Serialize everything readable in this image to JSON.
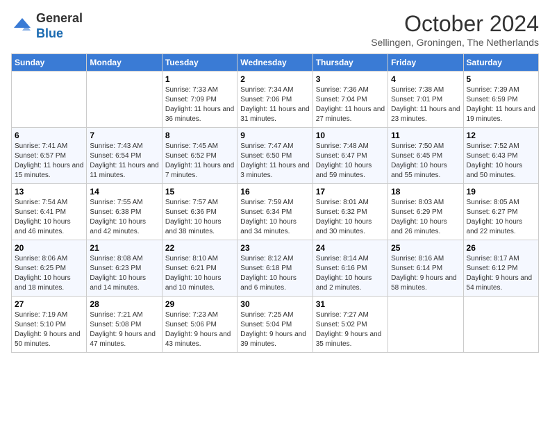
{
  "header": {
    "logo_line1": "General",
    "logo_line2": "Blue",
    "month_title": "October 2024",
    "subtitle": "Sellingen, Groningen, The Netherlands"
  },
  "weekdays": [
    "Sunday",
    "Monday",
    "Tuesday",
    "Wednesday",
    "Thursday",
    "Friday",
    "Saturday"
  ],
  "weeks": [
    [
      {
        "day": "",
        "info": ""
      },
      {
        "day": "",
        "info": ""
      },
      {
        "day": "1",
        "info": "Sunrise: 7:33 AM\nSunset: 7:09 PM\nDaylight: 11 hours and 36 minutes."
      },
      {
        "day": "2",
        "info": "Sunrise: 7:34 AM\nSunset: 7:06 PM\nDaylight: 11 hours and 31 minutes."
      },
      {
        "day": "3",
        "info": "Sunrise: 7:36 AM\nSunset: 7:04 PM\nDaylight: 11 hours and 27 minutes."
      },
      {
        "day": "4",
        "info": "Sunrise: 7:38 AM\nSunset: 7:01 PM\nDaylight: 11 hours and 23 minutes."
      },
      {
        "day": "5",
        "info": "Sunrise: 7:39 AM\nSunset: 6:59 PM\nDaylight: 11 hours and 19 minutes."
      }
    ],
    [
      {
        "day": "6",
        "info": "Sunrise: 7:41 AM\nSunset: 6:57 PM\nDaylight: 11 hours and 15 minutes."
      },
      {
        "day": "7",
        "info": "Sunrise: 7:43 AM\nSunset: 6:54 PM\nDaylight: 11 hours and 11 minutes."
      },
      {
        "day": "8",
        "info": "Sunrise: 7:45 AM\nSunset: 6:52 PM\nDaylight: 11 hours and 7 minutes."
      },
      {
        "day": "9",
        "info": "Sunrise: 7:47 AM\nSunset: 6:50 PM\nDaylight: 11 hours and 3 minutes."
      },
      {
        "day": "10",
        "info": "Sunrise: 7:48 AM\nSunset: 6:47 PM\nDaylight: 10 hours and 59 minutes."
      },
      {
        "day": "11",
        "info": "Sunrise: 7:50 AM\nSunset: 6:45 PM\nDaylight: 10 hours and 55 minutes."
      },
      {
        "day": "12",
        "info": "Sunrise: 7:52 AM\nSunset: 6:43 PM\nDaylight: 10 hours and 50 minutes."
      }
    ],
    [
      {
        "day": "13",
        "info": "Sunrise: 7:54 AM\nSunset: 6:41 PM\nDaylight: 10 hours and 46 minutes."
      },
      {
        "day": "14",
        "info": "Sunrise: 7:55 AM\nSunset: 6:38 PM\nDaylight: 10 hours and 42 minutes."
      },
      {
        "day": "15",
        "info": "Sunrise: 7:57 AM\nSunset: 6:36 PM\nDaylight: 10 hours and 38 minutes."
      },
      {
        "day": "16",
        "info": "Sunrise: 7:59 AM\nSunset: 6:34 PM\nDaylight: 10 hours and 34 minutes."
      },
      {
        "day": "17",
        "info": "Sunrise: 8:01 AM\nSunset: 6:32 PM\nDaylight: 10 hours and 30 minutes."
      },
      {
        "day": "18",
        "info": "Sunrise: 8:03 AM\nSunset: 6:29 PM\nDaylight: 10 hours and 26 minutes."
      },
      {
        "day": "19",
        "info": "Sunrise: 8:05 AM\nSunset: 6:27 PM\nDaylight: 10 hours and 22 minutes."
      }
    ],
    [
      {
        "day": "20",
        "info": "Sunrise: 8:06 AM\nSunset: 6:25 PM\nDaylight: 10 hours and 18 minutes."
      },
      {
        "day": "21",
        "info": "Sunrise: 8:08 AM\nSunset: 6:23 PM\nDaylight: 10 hours and 14 minutes."
      },
      {
        "day": "22",
        "info": "Sunrise: 8:10 AM\nSunset: 6:21 PM\nDaylight: 10 hours and 10 minutes."
      },
      {
        "day": "23",
        "info": "Sunrise: 8:12 AM\nSunset: 6:18 PM\nDaylight: 10 hours and 6 minutes."
      },
      {
        "day": "24",
        "info": "Sunrise: 8:14 AM\nSunset: 6:16 PM\nDaylight: 10 hours and 2 minutes."
      },
      {
        "day": "25",
        "info": "Sunrise: 8:16 AM\nSunset: 6:14 PM\nDaylight: 9 hours and 58 minutes."
      },
      {
        "day": "26",
        "info": "Sunrise: 8:17 AM\nSunset: 6:12 PM\nDaylight: 9 hours and 54 minutes."
      }
    ],
    [
      {
        "day": "27",
        "info": "Sunrise: 7:19 AM\nSunset: 5:10 PM\nDaylight: 9 hours and 50 minutes."
      },
      {
        "day": "28",
        "info": "Sunrise: 7:21 AM\nSunset: 5:08 PM\nDaylight: 9 hours and 47 minutes."
      },
      {
        "day": "29",
        "info": "Sunrise: 7:23 AM\nSunset: 5:06 PM\nDaylight: 9 hours and 43 minutes."
      },
      {
        "day": "30",
        "info": "Sunrise: 7:25 AM\nSunset: 5:04 PM\nDaylight: 9 hours and 39 minutes."
      },
      {
        "day": "31",
        "info": "Sunrise: 7:27 AM\nSunset: 5:02 PM\nDaylight: 9 hours and 35 minutes."
      },
      {
        "day": "",
        "info": ""
      },
      {
        "day": "",
        "info": ""
      }
    ]
  ]
}
